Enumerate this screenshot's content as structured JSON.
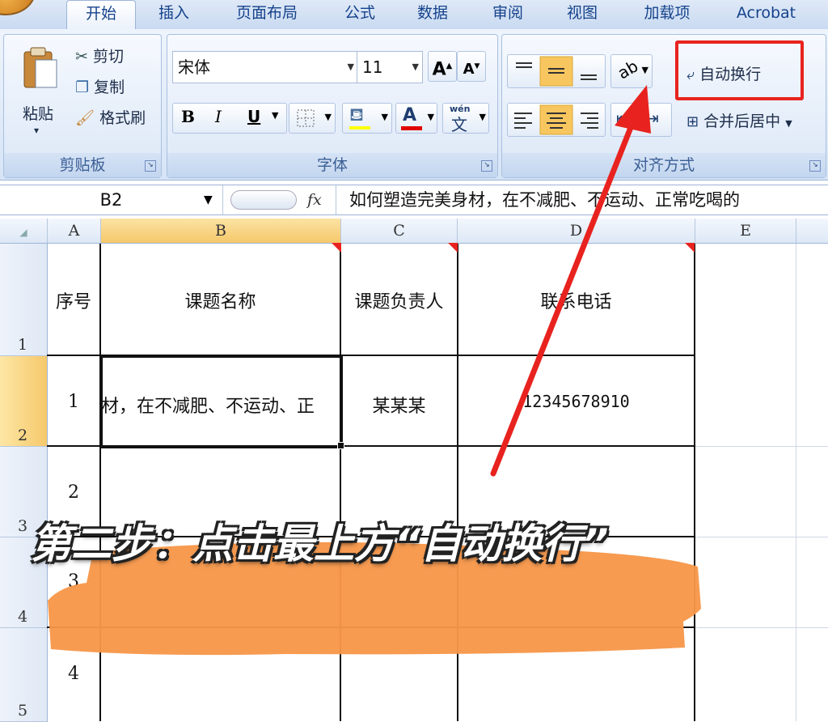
{
  "tabs": [
    "开始",
    "插入",
    "页面布局",
    "公式",
    "数据",
    "审阅",
    "视图",
    "加载项",
    "Acrobat"
  ],
  "clipboard": {
    "paste": "粘贴",
    "cut": "剪切",
    "copy": "复制",
    "format_painter": "格式刷",
    "group": "剪贴板"
  },
  "font": {
    "name": "宋体",
    "size": "11",
    "bold": "B",
    "italic": "I",
    "underline": "U",
    "color_letter": "A",
    "group": "字体",
    "wen": "wén",
    "wen_char": "文"
  },
  "alignment": {
    "wrap_text": "自动换行",
    "merge_center": "合并后居中",
    "group": "对齐方式"
  },
  "formula_bar": {
    "name_box": "B2",
    "fx": "fx",
    "content": "如何塑造完美身材，在不减肥、不运动、正常吃喝的"
  },
  "columns": [
    "A",
    "B",
    "C",
    "D",
    "E"
  ],
  "rows": [
    "1",
    "2",
    "3",
    "4",
    "5"
  ],
  "table": {
    "headers": [
      "序号",
      "课题名称",
      "课题负责人",
      "联系电话"
    ],
    "row2": {
      "seq": "1",
      "topic": "材，在不减肥、不运动、正",
      "owner": "某某某",
      "phone": "12345678910"
    },
    "seq_values": [
      "2",
      "3",
      "4"
    ]
  },
  "caption": "第二步：点击最上方“自动换行”",
  "colors": {
    "highlight_box": "#e8231f",
    "arrow": "#e8231f",
    "brush": "#f7974a",
    "accent": "#15428b"
  }
}
